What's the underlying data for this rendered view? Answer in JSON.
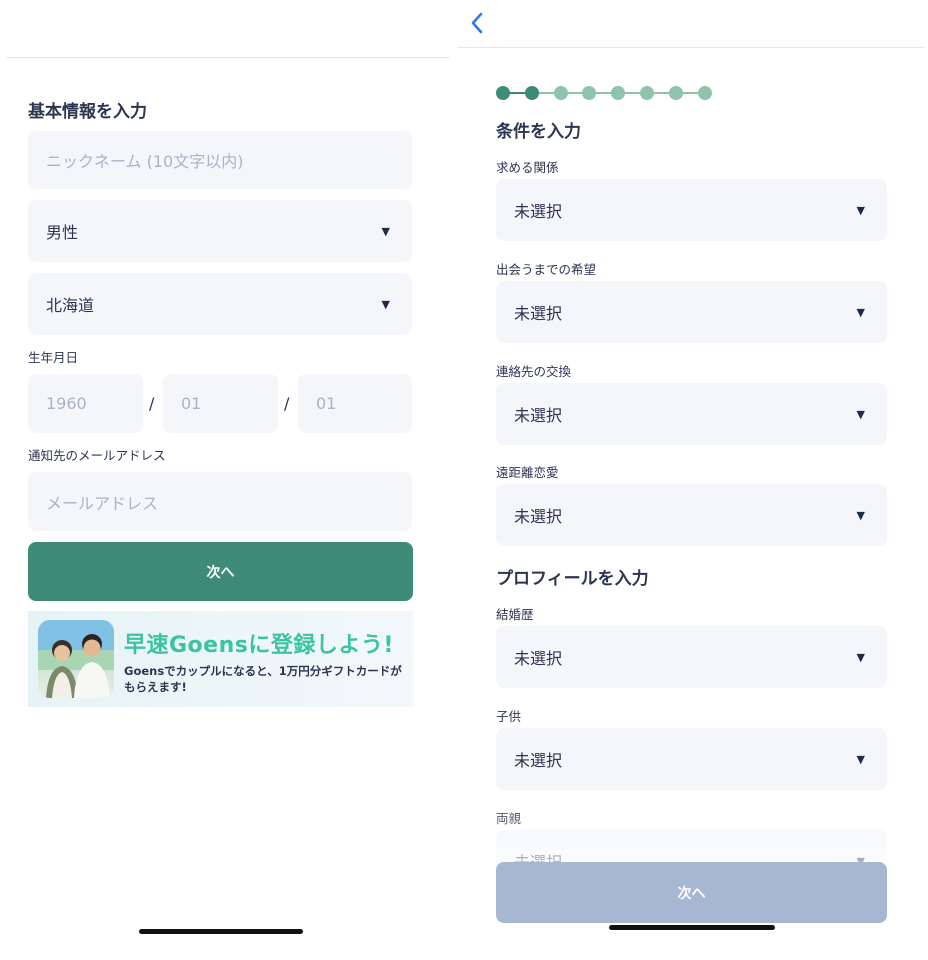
{
  "left": {
    "section_title": "基本情報を入力",
    "nickname": {
      "placeholder": "ニックネーム (10文字以内)"
    },
    "gender": {
      "value": "男性"
    },
    "prefecture": {
      "value": "北海道"
    },
    "birthday": {
      "label": "生年月日",
      "year": "1960",
      "month": "01",
      "day": "01",
      "separator": "/"
    },
    "email": {
      "label": "通知先のメールアドレス",
      "placeholder": "メールアドレス"
    },
    "next_button": "次へ",
    "banner": {
      "title": "早速Goensに登録しよう!",
      "text": "Goensでカップルになると、1万円分ギフトカードがもらえます!"
    }
  },
  "right": {
    "progress": {
      "total": 8,
      "completed": 2
    },
    "conditions_title": "条件を入力",
    "condition_fields": [
      {
        "label": "求める関係",
        "value": "未選択"
      },
      {
        "label": "出会うまでの希望",
        "value": "未選択"
      },
      {
        "label": "連絡先の交換",
        "value": "未選択"
      },
      {
        "label": "遠距離恋愛",
        "value": "未選択"
      }
    ],
    "profile_title": "プロフィールを入力",
    "profile_fields": [
      {
        "label": "結婚歴",
        "value": "未選択"
      },
      {
        "label": "子供",
        "value": "未選択"
      },
      {
        "label": "両親",
        "value": "未選択"
      }
    ],
    "next_button": "次へ"
  },
  "icons": {
    "back": "chevron-left-icon",
    "dropdown": "caret-down-icon"
  },
  "colors": {
    "primary": "#3e8b78",
    "disabled": "#a7b7d2",
    "field_bg": "#f4f6fa",
    "progress_done": "#3e8b78",
    "progress_todo": "#8fc4ab",
    "back_icon": "#2f7ae5",
    "banner_title": "#3cc3a4"
  }
}
